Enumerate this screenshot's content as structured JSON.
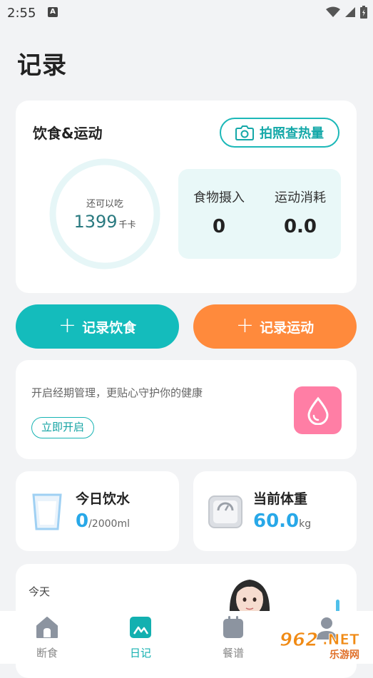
{
  "status_bar": {
    "time": "2:55",
    "notif_letter": "A"
  },
  "page": {
    "title": "记录"
  },
  "diet_card": {
    "title": "饮食&运动",
    "photo_button": "拍照查热量",
    "ring_sub": "还可以吃",
    "remaining_value": "1399",
    "remaining_unit": "千卡",
    "ring_progress": 0,
    "intake_label": "食物摄入",
    "intake_value": "0",
    "burn_label": "运动消耗",
    "burn_value": "0.0"
  },
  "actions": {
    "food_label": "记录饮食",
    "sport_label": "记录运动"
  },
  "period_card": {
    "text": "开启经期管理，更贴心守护你的健康",
    "button": "立即开启"
  },
  "water_card": {
    "title": "今日饮水",
    "value": "0",
    "unit": "/2000ml"
  },
  "weight_card": {
    "title": "当前体重",
    "value": "60.0",
    "unit": "kg"
  },
  "today_card": {
    "label": "今天"
  },
  "nav": [
    {
      "label": "断食",
      "icon": "house-icon"
    },
    {
      "label": "日记",
      "icon": "diary-icon"
    },
    {
      "label": "餐谱",
      "icon": "notebook-icon"
    },
    {
      "label": "",
      "icon": "profile-icon"
    }
  ],
  "watermark": {
    "main": "962.NET",
    "sub": "乐游网"
  },
  "colors": {
    "teal": "#14bcbc",
    "orange": "#ff8a3c",
    "pink": "#ff7ea5",
    "blue": "#28a8e8"
  }
}
